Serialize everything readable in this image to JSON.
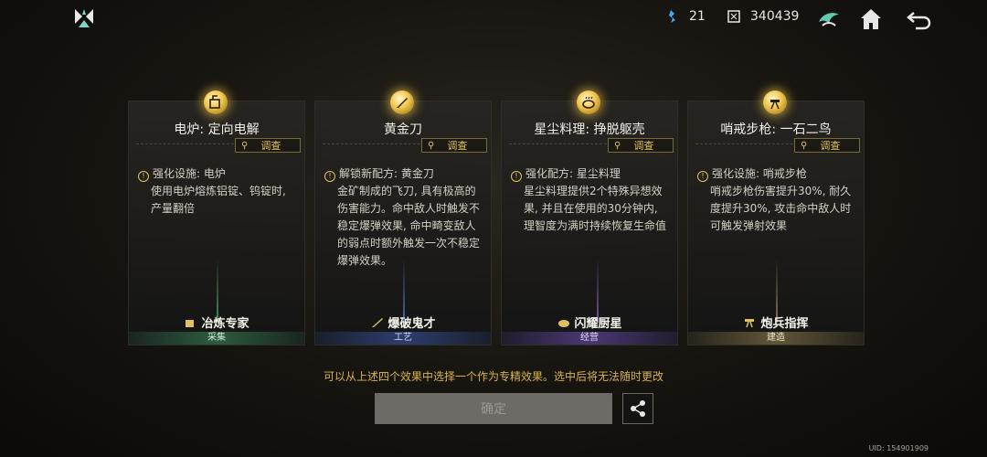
{
  "header": {
    "resource1": {
      "icon": "blue-crystal-icon",
      "value": "21"
    },
    "resource2": {
      "icon": "chip-currency-icon",
      "value": "340439"
    },
    "buttons": [
      "emblem-icon",
      "home-icon",
      "back-arrow-icon"
    ]
  },
  "cards": [
    {
      "title": "电炉: 定向电解",
      "survey": "调查",
      "desc_head": "强化设施: 电炉",
      "desc_body": "使用电炉熔炼铝锭、钨锭时, 产量翻倍",
      "talent": "冶炼专家",
      "category": "采集",
      "accent": "#3f8f5a"
    },
    {
      "title": "黄金刀",
      "survey": "调查",
      "desc_head": "解锁新配方: 黄金刀",
      "desc_body": "金矿制成的飞刀, 具有极高的伤害能力。命中敌人时触发不稳定爆弹效果, 命中畸变敌人的弱点时额外触发一次不稳定爆弹效果。",
      "talent": "爆破鬼才",
      "category": "工艺",
      "accent": "#4a6fb0"
    },
    {
      "title": "星尘料理: 挣脱躯壳",
      "survey": "调查",
      "desc_head": "强化配方: 星尘料理",
      "desc_body": "星尘料理提供2个特殊异想效果, 并且在使用的30分钟内, 理智度为满时持续恢复生命值",
      "talent": "闪耀厨星",
      "category": "经营",
      "accent": "#7b5fb8"
    },
    {
      "title": "哨戒步枪: 一石二鸟",
      "survey": "调查",
      "desc_head": "强化设施: 哨戒步枪",
      "desc_body": "哨戒步枪伤害提升30%, 耐久度提升30%, 攻击命中敌人时可触发弹射效果",
      "talent": "炮兵指挥",
      "category": "建造",
      "accent": "#b8a060"
    }
  ],
  "hint": "可以从上述四个效果中选择一个作为专精效果。选中后将无法随时更改",
  "confirm_label": "确定",
  "uid": "UID: 154901909"
}
